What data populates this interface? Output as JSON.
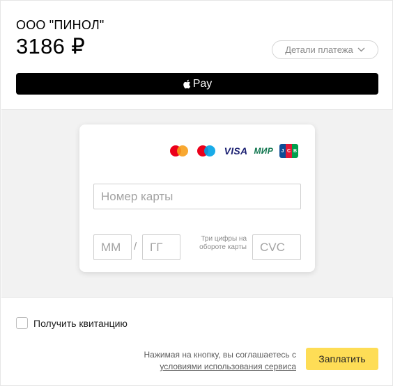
{
  "header": {
    "merchant": "ООО \"ПИНОЛ\"",
    "amount": "3186 ₽",
    "details_label": "Детали платежа"
  },
  "apple_pay": {
    "label": "Pay"
  },
  "card_form": {
    "card_logos": [
      "mastercard",
      "maestro",
      "VISA",
      "МИР",
      "JCB"
    ],
    "visa_text": "VISA",
    "mir_text": "МИР",
    "jcb_letters": [
      "J",
      "C",
      "B"
    ],
    "card_number_placeholder": "Номер карты",
    "month_placeholder": "ММ",
    "year_placeholder": "ГГ",
    "separator": "/",
    "cvc_hint": "Три цифры на обороте карты",
    "cvc_placeholder": "CVC"
  },
  "footer": {
    "receipt_label": "Получить квитанцию",
    "agreement_text": "Нажимая на кнопку, вы соглашаетесь с",
    "terms_link": "условиями использования сервиса",
    "pay_button": "Заплатить"
  },
  "colors": {
    "pay_button": "#fedd56",
    "apple_pay_bg": "#000000",
    "band_bg": "#f2f2f2",
    "mastercard_red": "#eb001b",
    "mastercard_orange": "#f79e1b",
    "maestro_blue": "#00a2e5",
    "visa_blue": "#1a1f71",
    "mir_green": "#0f754e"
  }
}
